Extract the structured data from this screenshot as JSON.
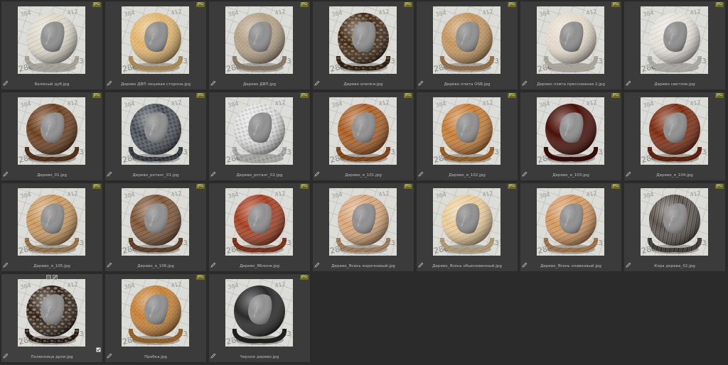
{
  "badge_text": "JPG",
  "materials": [
    {
      "label": "Беленый дуб.jpg",
      "base": "#e2ddd0",
      "dark": "#bdb6a6",
      "pattern": "grain"
    },
    {
      "label": "Дерево ДВП лицевая сторона.jpg",
      "base": "#e2b870",
      "dark": "#b58b47",
      "pattern": "speckle"
    },
    {
      "label": "Дерево ДВП.jpg",
      "base": "#b7a48a",
      "dark": "#8f7d66",
      "pattern": "speckle"
    },
    {
      "label": "Дерево опилки.jpg",
      "base": "#8a6a48",
      "dark": "#3b2817",
      "pattern": "chips"
    },
    {
      "label": "Дерево плита OSB.jpg",
      "base": "#c79a63",
      "dark": "#8c6438",
      "pattern": "speckle"
    },
    {
      "label": "Дерево плита прессованая 2.jpg",
      "base": "#e6dccd",
      "dark": "#c5b8a4",
      "pattern": "speckle"
    },
    {
      "label": "Дерево светлое.jpg",
      "base": "#e9e6df",
      "dark": "#c9c3b8",
      "pattern": "grain"
    },
    {
      "label": "Дерево_01.jpg",
      "base": "#7a4a26",
      "dark": "#3e2110",
      "pattern": "grain"
    },
    {
      "label": "Дерево_ротанг_01.jpg",
      "base": "#5a5f67",
      "dark": "#2c3036",
      "pattern": "weave"
    },
    {
      "label": "Дерево_ротанг_02.jpg",
      "base": "#e4e4e4",
      "dark": "#b9b9b9",
      "pattern": "weave"
    },
    {
      "label": "Дерево_я_101.jpg",
      "base": "#b86a2c",
      "dark": "#6e3610",
      "pattern": "grain"
    },
    {
      "label": "Дерево_я_102.jpg",
      "base": "#d0883f",
      "dark": "#93531c",
      "pattern": "grain"
    },
    {
      "label": "Дерево_я_103.jpg",
      "base": "#4a1108",
      "dark": "#1c0402",
      "pattern": "gloss"
    },
    {
      "label": "Дерево_я_104.jpg",
      "base": "#8a3517",
      "dark": "#4d1808",
      "pattern": "grain"
    },
    {
      "label": "Дерево_я_105.jpg",
      "base": "#d4a46a",
      "dark": "#8f6436",
      "pattern": "grain"
    },
    {
      "label": "Дерево_я_106.jpg",
      "base": "#8a6040",
      "dark": "#4a2e18",
      "pattern": "grain"
    },
    {
      "label": "Дерево_Яблоня.jpg",
      "base": "#b44a2a",
      "dark": "#6a2010",
      "pattern": "grain"
    },
    {
      "label": "Дерево_Ясень коричневый.jpg",
      "base": "#deb084",
      "dark": "#a87346",
      "pattern": "grain"
    },
    {
      "label": "Дерево_Ясень обыкновенный.jpg",
      "base": "#eed2a2",
      "dark": "#caa56c",
      "pattern": "grain"
    },
    {
      "label": "Дерево_Ясень оливковый.jpg",
      "base": "#dca16a",
      "dark": "#a26a36",
      "pattern": "grain"
    },
    {
      "label": "Кора дерева_02.jpg",
      "base": "#6c655c",
      "dark": "#302b26",
      "pattern": "bark"
    },
    {
      "label": "Поленница дров.jpg",
      "base": "#8d7860",
      "dark": "#2d2219",
      "pattern": "chips"
    },
    {
      "label": "Пробка.jpg",
      "base": "#c9853a",
      "dark": "#8c5214",
      "pattern": "speckle"
    },
    {
      "label": "Черное дерево.jpg",
      "base": "#2a2a2a",
      "dark": "#0a0a0a",
      "pattern": "gloss"
    }
  ]
}
